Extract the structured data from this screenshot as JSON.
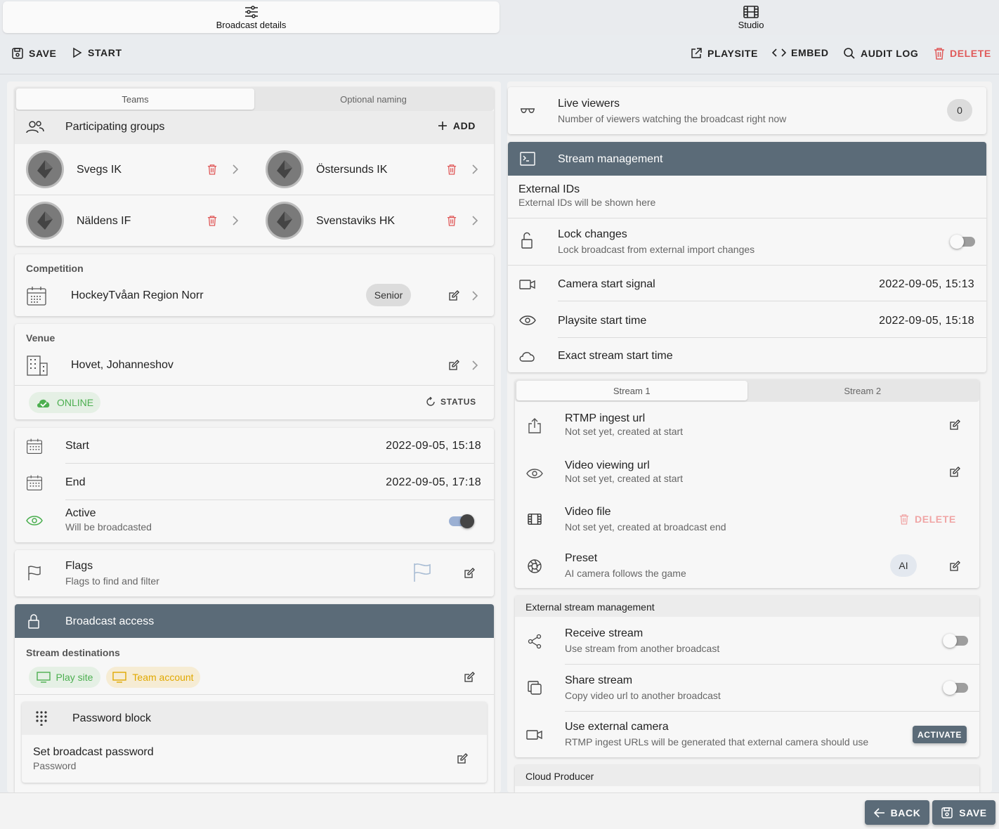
{
  "top_tabs": [
    {
      "label": "Broadcast details",
      "icon": "sliders-icon",
      "active": true
    },
    {
      "label": "Studio",
      "icon": "film-icon",
      "active": false
    }
  ],
  "toolbar": {
    "save": "SAVE",
    "start": "START",
    "playsite": "PLAYSITE",
    "embed": "EMBED",
    "audit_log": "AUDIT LOG",
    "delete": "DELETE"
  },
  "teams": {
    "tabs": [
      "Teams",
      "Optional naming"
    ],
    "header": "Participating groups",
    "add": "ADD",
    "items": [
      "Svegs IK",
      "Östersunds IK",
      "Näldens IF",
      "Svenstaviks HK"
    ]
  },
  "competition": {
    "heading": "Competition",
    "name": "HockeyTvåan Region Norr",
    "chip": "Senior"
  },
  "venue": {
    "heading": "Venue",
    "name": "Hovet, Johanneshov",
    "status_chip": "ONLINE",
    "status_button": "STATUS"
  },
  "schedule": {
    "start_label": "Start",
    "start_value": "2022-09-05, 15:18",
    "end_label": "End",
    "end_value": "2022-09-05, 17:18",
    "active_label": "Active",
    "active_sub": "Will be broadcasted",
    "active_on": true
  },
  "flags": {
    "label": "Flags",
    "sub": "Flags to find and filter"
  },
  "broadcast_access": {
    "header": "Broadcast access",
    "destinations_heading": "Stream destinations",
    "chips": [
      "Play site",
      "Team account"
    ],
    "password_header": "Password block",
    "password_label": "Set broadcast password",
    "password_sub": "Password"
  },
  "live_viewers": {
    "label": "Live viewers",
    "sub": "Number of viewers watching the broadcast right now",
    "count": "0"
  },
  "stream_management": {
    "header": "Stream management",
    "external_ids_label": "External IDs",
    "external_ids_sub": "External IDs will be shown here",
    "lock_label": "Lock changes",
    "lock_sub": "Lock broadcast from external import changes",
    "camera_start_label": "Camera start signal",
    "camera_start_value": "2022-09-05, 15:13",
    "playsite_start_label": "Playsite start time",
    "playsite_start_value": "2022-09-05, 15:18",
    "exact_start_label": "Exact stream start time"
  },
  "streams": {
    "tabs": [
      "Stream 1",
      "Stream 2"
    ],
    "rtmp_label": "RTMP ingest url",
    "rtmp_sub": "Not set yet, created at start",
    "video_url_label": "Video viewing url",
    "video_url_sub": "Not set yet, created at start",
    "video_file_label": "Video file",
    "video_file_sub": "Not set yet, created at broadcast end",
    "video_file_delete": "DELETE",
    "preset_label": "Preset",
    "preset_sub": "AI camera follows the game",
    "preset_chip": "AI"
  },
  "external_stream": {
    "heading": "External stream management",
    "receive_label": "Receive stream",
    "receive_sub": "Use stream from another broadcast",
    "share_label": "Share stream",
    "share_sub": "Copy video url to another broadcast",
    "ext_cam_label": "Use external camera",
    "ext_cam_sub": "RTMP ingest URLs will be generated that external camera should use",
    "activate": "ACTIVATE"
  },
  "cloud_producer": {
    "heading": "Cloud Producer"
  },
  "footer": {
    "back": "BACK",
    "save": "SAVE"
  },
  "colors": {
    "accent_dark": "#5b6b78",
    "danger": "#e05a5a",
    "online_green": "#4caf50",
    "team_account_amber": "#e0a800"
  }
}
